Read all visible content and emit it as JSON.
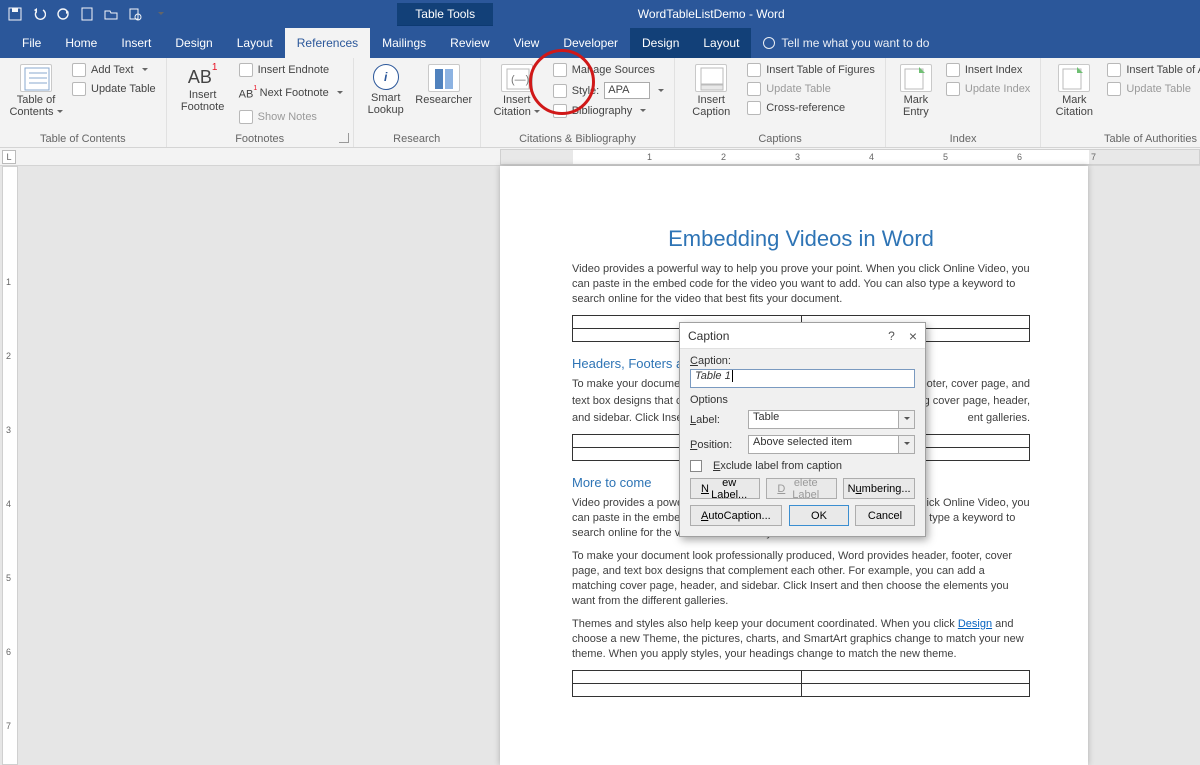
{
  "titlebar": {
    "context_tab": "Table Tools",
    "doc_title": "WordTableListDemo  -  Word"
  },
  "tabs": {
    "file": "File",
    "home": "Home",
    "insert": "Insert",
    "design": "Design",
    "layout": "Layout",
    "references": "References",
    "mailings": "Mailings",
    "review": "Review",
    "view": "View",
    "developer": "Developer",
    "ctx_design": "Design",
    "ctx_layout": "Layout",
    "tell_me": "Tell me what you want to do"
  },
  "ribbon": {
    "toc": {
      "big": "Table of\nContents",
      "add_text": "Add Text",
      "update": "Update Table",
      "group": "Table of Contents"
    },
    "footnotes": {
      "big": "Insert\nFootnote",
      "ab_label": "AB",
      "endnote": "Insert Endnote",
      "next": "Next Footnote",
      "show": "Show Notes",
      "group": "Footnotes"
    },
    "research": {
      "smart": "Smart\nLookup",
      "researcher": "Researcher",
      "group": "Research"
    },
    "citations": {
      "big": "Insert\nCitation",
      "manage": "Manage Sources",
      "style_label": "Style:",
      "style_value": "APA",
      "biblio": "Bibliography",
      "group": "Citations & Bibliography"
    },
    "captions": {
      "big": "Insert\nCaption",
      "tof": "Insert Table of Figures",
      "update": "Update Table",
      "cross": "Cross-reference",
      "group": "Captions"
    },
    "index": {
      "big": "Mark\nEntry",
      "insert": "Insert Index",
      "update": "Update Index",
      "group": "Index"
    },
    "toa": {
      "big": "Mark\nCitation",
      "insert": "Insert Table of Authorities",
      "update": "Update Table",
      "group": "Table of Authorities"
    }
  },
  "ruler": {
    "corner": "L",
    "h_ticks": [
      "1",
      "2",
      "3",
      "4",
      "5",
      "6",
      "7"
    ],
    "v_ticks": [
      "1",
      "2",
      "3",
      "4",
      "5",
      "6",
      "7"
    ]
  },
  "document": {
    "h1": "Embedding Videos in Word",
    "p1": "Video provides a powerful way to help you prove your point. When you click Online Video, you can paste in the embed code for the video you want to add. You can also type a keyword to search online for the video that best fits your document.",
    "h2a": "Headers, Footers an",
    "p2a": "To make your documen",
    "p2b": "text box designs that co",
    "p2c": "and sidebar. Click Insert",
    "p2a_right": "ooter, cover page, and",
    "p2b_right": "hing cover page, header,",
    "p2c_right": "ent galleries.",
    "h2b": "More to come",
    "p3": "Video provides a powerful way to help you prove your point. When you click Online Video, you can paste in the embed code for the video you want to add. You can also type a keyword to search online for the video that best fits your document.",
    "p4": "To make your document look professionally produced, Word provides header, footer, cover page, and text box designs that complement each other. For example, you can add a matching cover page, header, and sidebar. Click Insert and then choose the elements you want from the different galleries.",
    "p5a": "Themes and styles also help keep your document coordinated. When you click ",
    "p5_link": "Design",
    "p5b": " and choose a new Theme, the pictures, charts, and SmartArt graphics change to match your new theme. When you apply styles, your headings change to match the new theme."
  },
  "dialog": {
    "title": "Caption",
    "help": "?",
    "close": "×",
    "caption_label": "Caption:",
    "caption_value": "Table  1",
    "options": "Options",
    "label_label": "Label:",
    "label_value": "Table",
    "position_label": "Position:",
    "position_value": "Above selected item",
    "exclude": "Exclude label from caption",
    "new_label": "New Label...",
    "delete_label": "Delete Label",
    "numbering": "Numbering...",
    "autocaption": "AutoCaption...",
    "ok": "OK",
    "cancel": "Cancel"
  }
}
